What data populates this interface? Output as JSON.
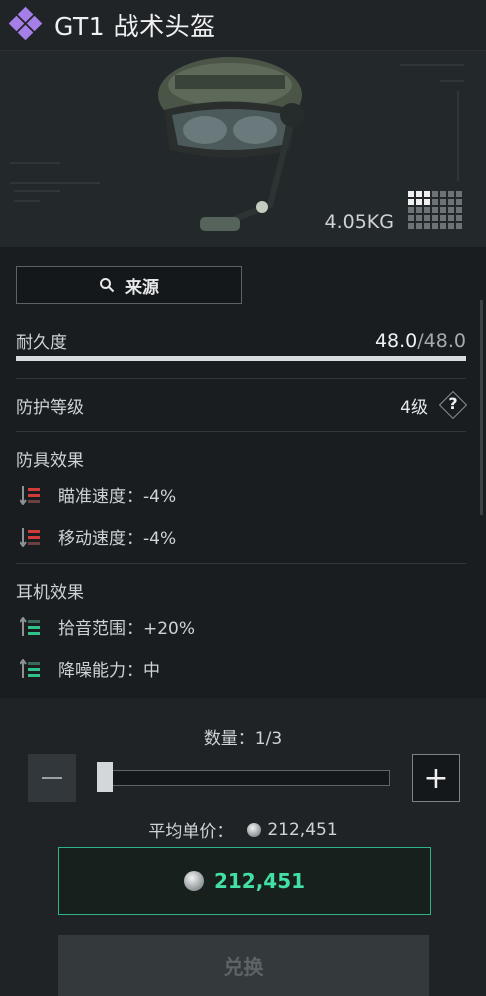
{
  "header": {
    "title": "GT1 战术头盔",
    "rarity_color": "#a67ee8"
  },
  "preview": {
    "weight": "4.05KG",
    "image": "tactical-helmet"
  },
  "source_button": {
    "label": "来源",
    "icon": "search-icon"
  },
  "durability": {
    "label": "耐久度",
    "current": "48.0",
    "max": "/48.0",
    "fill_fraction": 1.0
  },
  "protection": {
    "label": "防护等级",
    "value": "4级",
    "help": "?"
  },
  "armor_effects": {
    "title": "防具效果",
    "items": [
      {
        "text": "瞄准速度：-4%",
        "icon": "debuff-red-icon"
      },
      {
        "text": "移动速度：-4%",
        "icon": "debuff-red-icon"
      }
    ]
  },
  "headset_effects": {
    "title": "耳机效果",
    "items": [
      {
        "text": "拾音范围：+20%",
        "icon": "buff-green-icon"
      },
      {
        "text": "降噪能力：中",
        "icon": "buff-green-icon"
      }
    ]
  },
  "purchase": {
    "quantity_label": "数量：1/3",
    "slider_fraction": 0.0,
    "avg_price_label": "平均单价：",
    "avg_price": "212,451",
    "total_price": "212,451",
    "exchange_label": "兑换",
    "accent_color": "#43e0a6"
  }
}
